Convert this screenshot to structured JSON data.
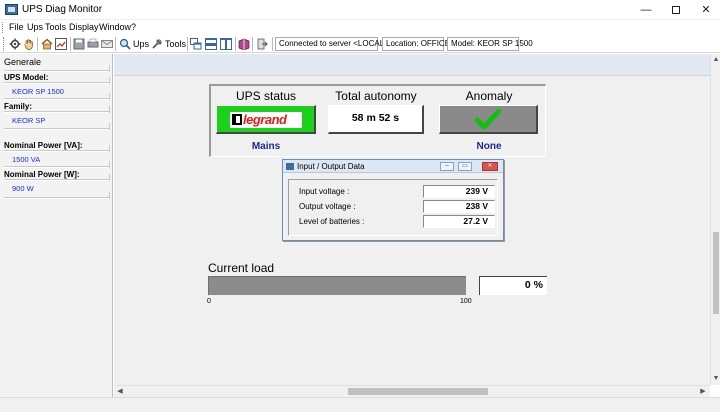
{
  "window": {
    "title": "UPS Diag Monitor",
    "minimize": "—",
    "close": "✕"
  },
  "menu": [
    "File",
    "Ups",
    "Tools",
    "Display",
    "Window",
    "?"
  ],
  "toolbar": {
    "ups_label": "Ups",
    "tools_label": "Tools",
    "connection_status": "Connected to server <LOCAL>",
    "location": "Location: OFFICE",
    "model": "Model: KEOR SP 1500"
  },
  "sidebar": {
    "title": "Generale",
    "fields": [
      {
        "label": "UPS Model:",
        "value": "KEOR SP 1500"
      },
      {
        "label": "Family:",
        "value": "KEOR SP"
      },
      {
        "label": "Nominal Power [VA]:",
        "value": "1500 VA"
      },
      {
        "label": "Nominal Power [W]:",
        "value": "900 W"
      }
    ]
  },
  "status_panel": {
    "ups_status_title": "UPS status",
    "ups_status_logo": "legrand",
    "ups_status_value": "Mains",
    "autonomy_title": "Total autonomy",
    "autonomy_value": "58 m  52 s",
    "anomaly_title": "Anomaly",
    "anomaly_value": "None",
    "colors": {
      "ok_green": "#1cd11c",
      "label_blue": "#1e2a8c",
      "logo_red": "#e41b13",
      "check_green": "#10c010"
    }
  },
  "io_dialog": {
    "title": "Input / Output Data",
    "rows": [
      {
        "label": "Input voltage :",
        "value": "239 V"
      },
      {
        "label": "Output voltage :",
        "value": "238 V"
      },
      {
        "label": "Level of batteries :",
        "value": "27.2 V"
      }
    ]
  },
  "load": {
    "title": "Current load",
    "value_text": "0 %",
    "fraction": 0,
    "tick_min": "0",
    "tick_max": "100"
  }
}
